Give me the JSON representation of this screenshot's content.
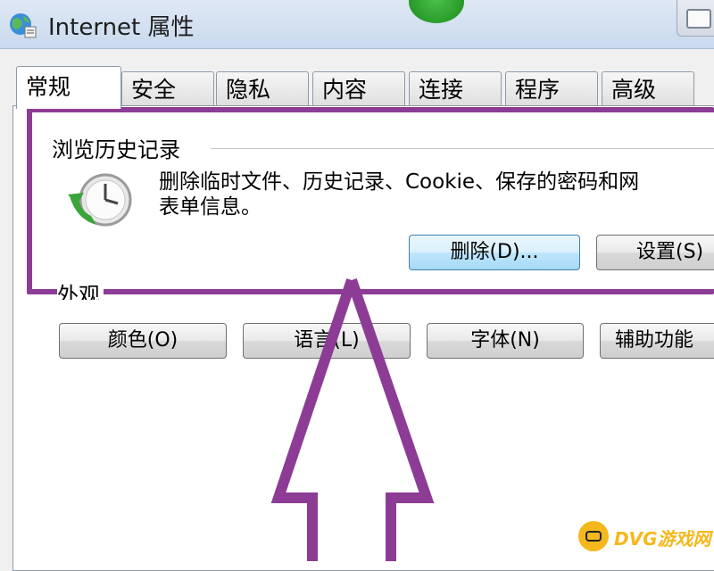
{
  "window": {
    "title": "Internet 属性"
  },
  "tabs": [
    {
      "label": "常规",
      "active": true
    },
    {
      "label": "安全",
      "active": false
    },
    {
      "label": "隐私",
      "active": false
    },
    {
      "label": "内容",
      "active": false
    },
    {
      "label": "连接",
      "active": false
    },
    {
      "label": "程序",
      "active": false
    },
    {
      "label": "高级",
      "active": false
    }
  ],
  "browsing_history": {
    "group_label": "浏览历史记录",
    "description_line1": "删除临时文件、历史记录、Cookie、保存的密码和网",
    "description_line2": "表单信息。",
    "delete_button": "删除(D)...",
    "settings_button": "设置(S)"
  },
  "appearance": {
    "group_label": "外观",
    "colors_button": "颜色(O)",
    "languages_button": "语言(L)",
    "fonts_button": "字体(N)",
    "accessibility_button": "辅助功能"
  },
  "annotation": {
    "highlight_color": "#8d3c96"
  },
  "watermark": {
    "text": "DVG游戏网"
  }
}
